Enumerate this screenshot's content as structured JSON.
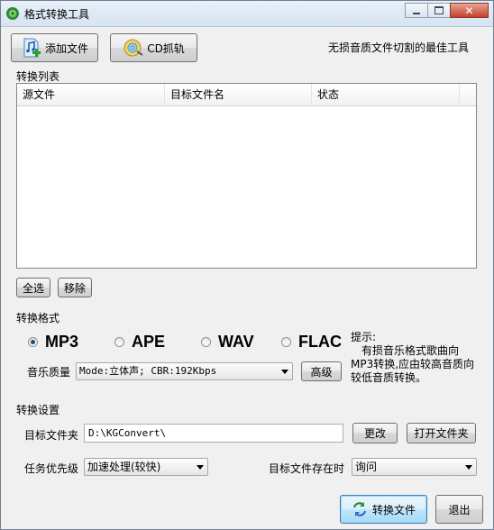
{
  "window": {
    "title": "格式转换工具",
    "minimize_icon": "minimize-icon",
    "maximize_icon": "maximize-icon",
    "close_icon": "close-icon"
  },
  "toolbar": {
    "add_file_label": "添加文件",
    "add_file_icon": "add-music-file-icon",
    "cd_rip_label": "CD抓轨",
    "cd_rip_icon": "cd-disc-icon",
    "slogan": "无损音质文件切割的最佳工具"
  },
  "convert_list": {
    "group_label": "转换列表",
    "columns": [
      "源文件",
      "目标文件名",
      "状态"
    ],
    "rows": [],
    "select_all_label": "全选",
    "remove_label": "移除"
  },
  "format": {
    "group_label": "转换格式",
    "options": [
      {
        "label": "MP3",
        "selected": true
      },
      {
        "label": "APE",
        "selected": false
      },
      {
        "label": "WAV",
        "selected": false
      },
      {
        "label": "FLAC",
        "selected": false
      }
    ],
    "quality_label": "音乐质量",
    "quality_value": "Mode:立体声; CBR:192Kbps",
    "advanced_label": "高级",
    "tip_title": "提示:",
    "tip_text": "有损音乐格式歌曲向MP3转换,应由较高音质向较低音质转换。"
  },
  "settings": {
    "group_label": "转换设置",
    "target_folder_label": "目标文件夹",
    "target_folder_value": "D:\\KGConvert\\",
    "change_label": "更改",
    "open_folder_label": "打开文件夹",
    "priority_label": "任务优先级",
    "priority_value": "加速处理(较快)",
    "exists_label": "目标文件存在时",
    "exists_value": "询问"
  },
  "footer": {
    "convert_label": "转换文件",
    "convert_icon": "convert-arrows-icon",
    "exit_label": "退出"
  },
  "colors": {
    "window_bg": "#f0f0f0",
    "titlebar": "#dbe6f3",
    "close_button": "#c5412a",
    "focus_button": "#bee6fd"
  }
}
